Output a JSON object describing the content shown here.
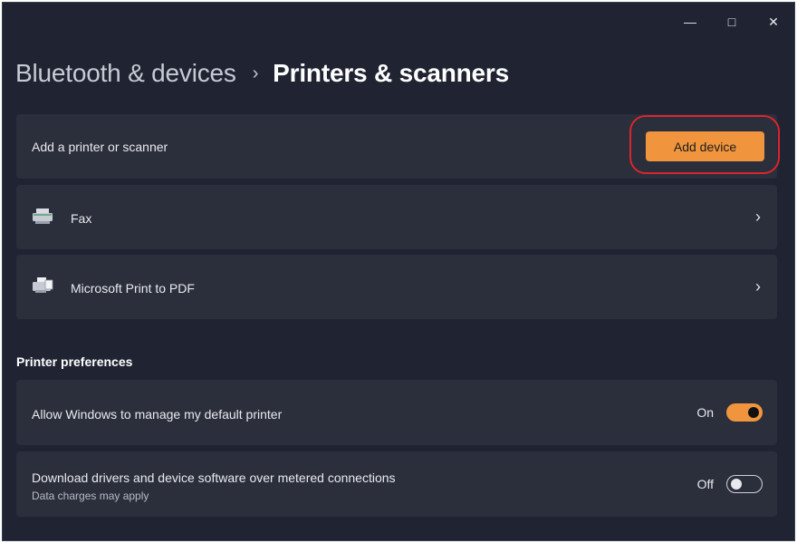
{
  "window": {
    "minimize": "—",
    "maximize": "□",
    "close": "✕"
  },
  "breadcrumb": {
    "parent": "Bluetooth & devices",
    "separator": "›",
    "current": "Printers & scanners"
  },
  "add_printer": {
    "label": "Add a printer or scanner",
    "button": "Add device"
  },
  "devices": [
    {
      "label": "Fax",
      "icon": "fax-icon"
    },
    {
      "label": "Microsoft Print to PDF",
      "icon": "printer-icon"
    }
  ],
  "preferences": {
    "title": "Printer preferences",
    "items": [
      {
        "label": "Allow Windows to manage my default printer",
        "state": "On"
      },
      {
        "label": "Download drivers and device software over metered connections",
        "sublabel": "Data charges may apply",
        "state": "Off"
      }
    ]
  },
  "colors": {
    "accent": "#f0953d",
    "highlight": "#d9262c",
    "background": "#202432",
    "card": "#2b2f3c"
  }
}
